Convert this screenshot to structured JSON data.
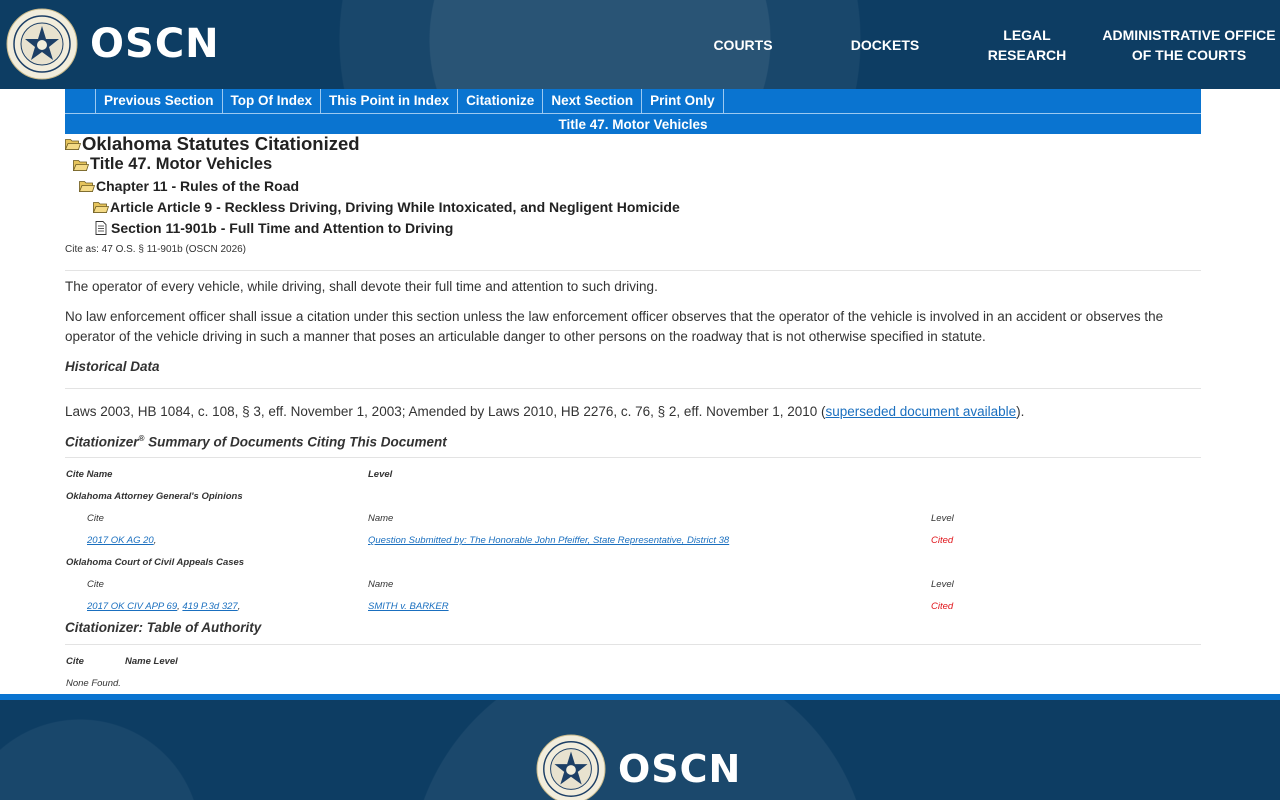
{
  "header": {
    "logo_text": "OSCN",
    "nav": [
      {
        "label": "COURTS"
      },
      {
        "label": "DOCKETS"
      },
      {
        "label": "LEGAL\nRESEARCH"
      },
      {
        "label": "ADMINISTRATIVE OFFICE\nOF THE COURTS"
      }
    ]
  },
  "toolbar": {
    "previous_section": "Previous Section",
    "top_of_index": "Top Of Index",
    "this_point_in_index": "This Point in Index",
    "citationize": "Citationize",
    "next_section": "Next Section",
    "print_only": "Print Only"
  },
  "title_bar": "Title 47. Motor Vehicles",
  "tree": {
    "level1": "Oklahoma Statutes Citationized",
    "level2": "Title 47. Motor Vehicles",
    "level3": "Chapter 11 - Rules of the Road",
    "level4": "Article Article 9 - Reckless Driving, Driving While Intoxicated, and Negligent Homicide",
    "level5": "Section 11-901b - Full Time and Attention to Driving"
  },
  "cite_as": "Cite as: 47 O.S. § 11-901b (OSCN 2026)",
  "statute": {
    "para1": "The operator of every vehicle, while driving, shall devote their full time and attention to such driving.",
    "para2": "No law enforcement officer shall issue a citation under this section unless the law enforcement officer observes that the operator of the vehicle is involved in an accident or observes the operator of the vehicle driving in such a manner that poses an articulable danger to other persons on the roadway that is not otherwise specified in statute."
  },
  "historical": {
    "heading": "Historical Data",
    "text_before": "Laws 2003, HB 1084, c. 108, § 3, eff. November 1, 2003; Amended by Laws 2010, HB 2276, c. 76, § 2, eff. November 1, 2010 (",
    "link": "superseded document available",
    "text_after": ")."
  },
  "summary": {
    "heading": "Citationizer",
    "heading_sup": "®",
    "heading_rest": " Summary of Documents Citing This Document",
    "col_cite_name": "Cite Name",
    "col_level": "Level",
    "groups": [
      {
        "name": "Oklahoma Attorney General's Opinions",
        "col_cite": "Cite",
        "col_name": "Name",
        "col_level": "Level",
        "cite_links": [
          "2017 OK AG 20"
        ],
        "cite_after": ",",
        "case_name": "Question Submitted by: The Honorable John Pfeiffer, State Representative, District 38",
        "level": "Cited"
      },
      {
        "name": "Oklahoma Court of Civil Appeals Cases",
        "col_cite": "Cite",
        "col_name": "Name",
        "col_level": "Level",
        "cite_links": [
          "2017 OK CIV APP 69",
          "419 P.3d 327"
        ],
        "cite_after": ",",
        "case_name": "SMITH v. BARKER",
        "level": "Cited"
      }
    ]
  },
  "authority": {
    "heading": "Citationizer: Table of Authority",
    "col_cite": "Cite",
    "col_name_level": "Name Level",
    "none_found": "None Found."
  },
  "footer": {
    "logo_text": "OSCN"
  },
  "colors": {
    "navy": "#0d3d63",
    "toolbar_blue": "#0a74d0",
    "link": "#1a6fbf",
    "cited_red": "#e0141a"
  }
}
